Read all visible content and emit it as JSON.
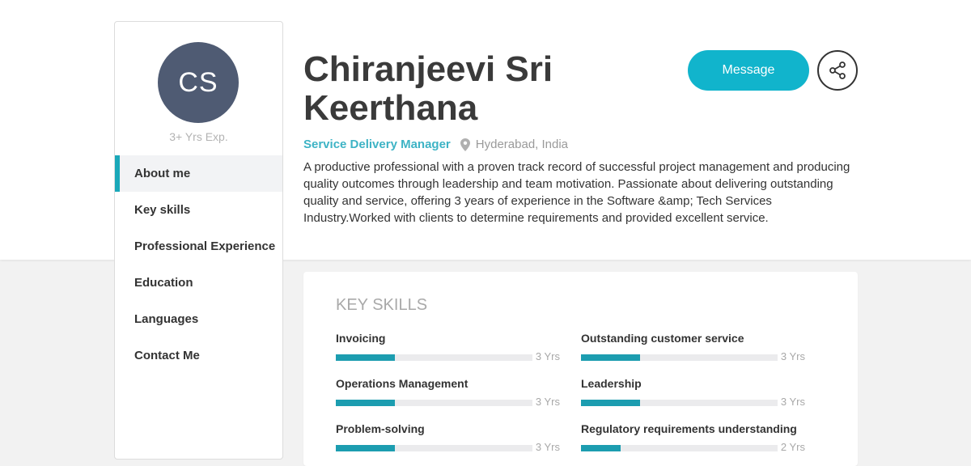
{
  "profile": {
    "initials": "CS",
    "experience": "3+ Yrs Exp.",
    "name_line1": "Chiranjeevi Sri",
    "name_line2": "Keerthana",
    "role": "Service Delivery Manager",
    "location": "Hyderabad, India",
    "about": "A productive professional with a proven track record of successful project management and producing quality outcomes through leadership and team motivation. Passionate about delivering outstanding quality and service, offering 3 years of experience in the Software &amp; Tech Services Industry.Worked with clients to determine requirements and provided excellent service."
  },
  "actions": {
    "message_label": "Message",
    "share_icon": "share-icon"
  },
  "sidebar": {
    "items": [
      {
        "label": "About me",
        "active": true
      },
      {
        "label": "Key skills",
        "active": false
      },
      {
        "label": "Professional Experience",
        "active": false
      },
      {
        "label": "Education",
        "active": false
      },
      {
        "label": "Languages",
        "active": false
      },
      {
        "label": "Contact Me",
        "active": false
      }
    ]
  },
  "skills": {
    "title": "KEY SKILLS",
    "items": [
      {
        "name": "Invoicing",
        "years": "3 Yrs",
        "level": 0.3
      },
      {
        "name": "Outstanding customer service",
        "years": "3 Yrs",
        "level": 0.3
      },
      {
        "name": "Operations Management",
        "years": "3 Yrs",
        "level": 0.3
      },
      {
        "name": "Leadership",
        "years": "3 Yrs",
        "level": 0.3
      },
      {
        "name": "Problem-solving",
        "years": "3 Yrs",
        "level": 0.3
      },
      {
        "name": "Regulatory requirements understanding",
        "years": "2 Yrs",
        "level": 0.2
      }
    ]
  },
  "colors": {
    "accent": "#11b4cc",
    "avatar_bg": "#4f5b73",
    "bar_fill": "#1c9db0"
  }
}
